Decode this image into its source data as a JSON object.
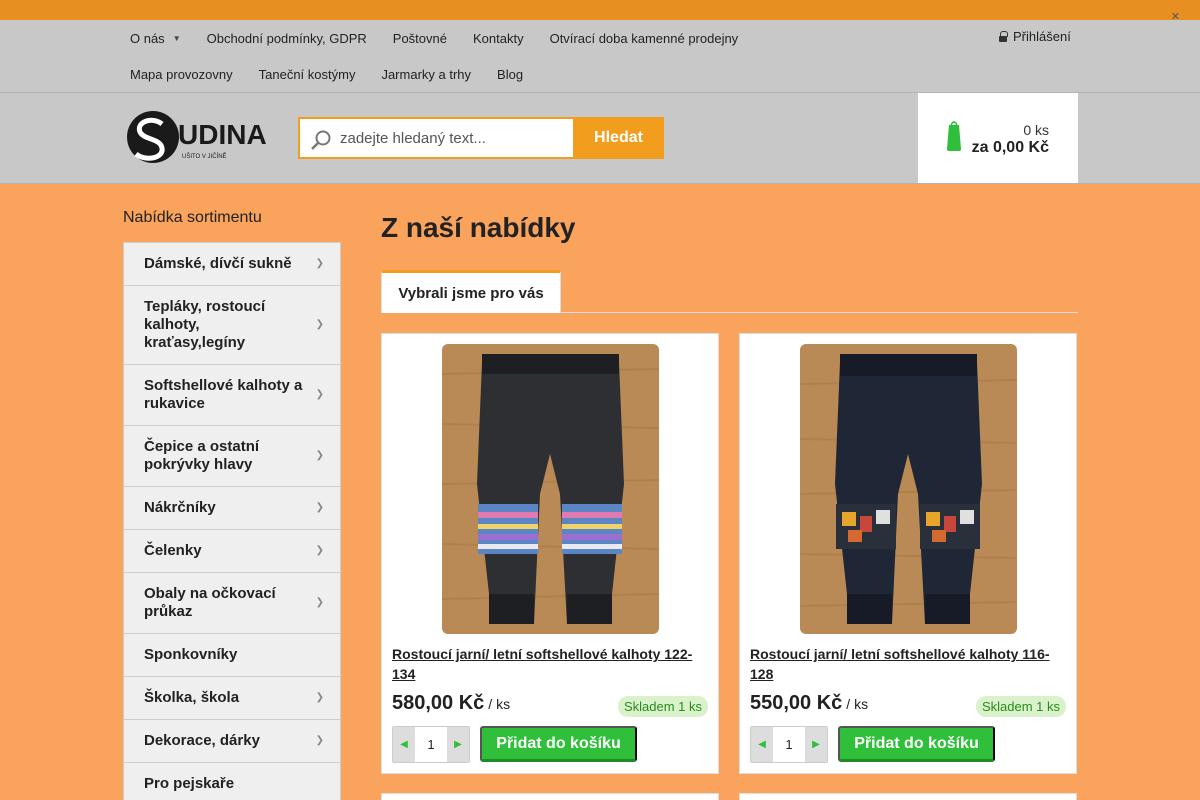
{
  "topbar": {
    "close_icon": "close-icon"
  },
  "nav": {
    "row1": [
      {
        "label": "O nás",
        "has_caret": true
      },
      {
        "label": "Obchodní podmínky, GDPR"
      },
      {
        "label": "Poštovné"
      },
      {
        "label": "Kontakty"
      },
      {
        "label": "Otvírací doba kamenné prodejny"
      }
    ],
    "row2": [
      {
        "label": "Mapa provozovny"
      },
      {
        "label": "Taneční kostýmy"
      },
      {
        "label": "Jarmarky a trhy"
      },
      {
        "label": "Blog"
      }
    ],
    "login_label": "Přihlášení"
  },
  "header": {
    "logo_text": "UDINA",
    "logo_tagline": "UŠITO V JIČÍNĚ",
    "search_placeholder": "zadejte hledaný text...",
    "search_button": "Hledat",
    "cart_qty": "0 ks",
    "cart_total": "za 0,00 Kč"
  },
  "sidebar": {
    "title": "Nabídka sortimentu",
    "items": [
      {
        "label": "Dámské, dívčí sukně",
        "has_children": true
      },
      {
        "label": "Tepláky, rostoucí kalhoty, kraťasy,legíny",
        "has_children": true
      },
      {
        "label": "Softshellové kalhoty a rukavice",
        "has_children": true
      },
      {
        "label": "Čepice a ostatní pokrývky hlavy",
        "has_children": true
      },
      {
        "label": "Nákrčníky",
        "has_children": true
      },
      {
        "label": "Čelenky",
        "has_children": true
      },
      {
        "label": "Obaly na očkovací průkaz",
        "has_children": true
      },
      {
        "label": "Sponkovníky",
        "has_children": false
      },
      {
        "label": "Školka, škola",
        "has_children": true
      },
      {
        "label": "Dekorace, dárky",
        "has_children": true
      },
      {
        "label": "Pro pejskaře",
        "has_children": false
      }
    ]
  },
  "main": {
    "title": "Z naší nabídky",
    "tab_label": "Vybrali jsme pro vás",
    "products": [
      {
        "name": "Rostoucí jarní/ letní softshellové kalhoty 122-134",
        "price": "580,00 Kč",
        "unit": "/ ks",
        "stock": "Skladem 1 ks",
        "qty": "1",
        "add_label": "Přidat do košíku",
        "patch_color": "stripes"
      },
      {
        "name": "Rostoucí jarní/ letní softshellové kalhoty 116-128",
        "price": "550,00 Kč",
        "unit": "/ ks",
        "stock": "Skladem 1 ks",
        "qty": "1",
        "add_label": "Přidat do košíku",
        "patch_color": "animals"
      }
    ]
  },
  "colors": {
    "page_bg": "#f9a35c",
    "accent_orange": "#f29d1d",
    "green": "#2fbf3a",
    "nav_bg": "#c8c8c8"
  }
}
